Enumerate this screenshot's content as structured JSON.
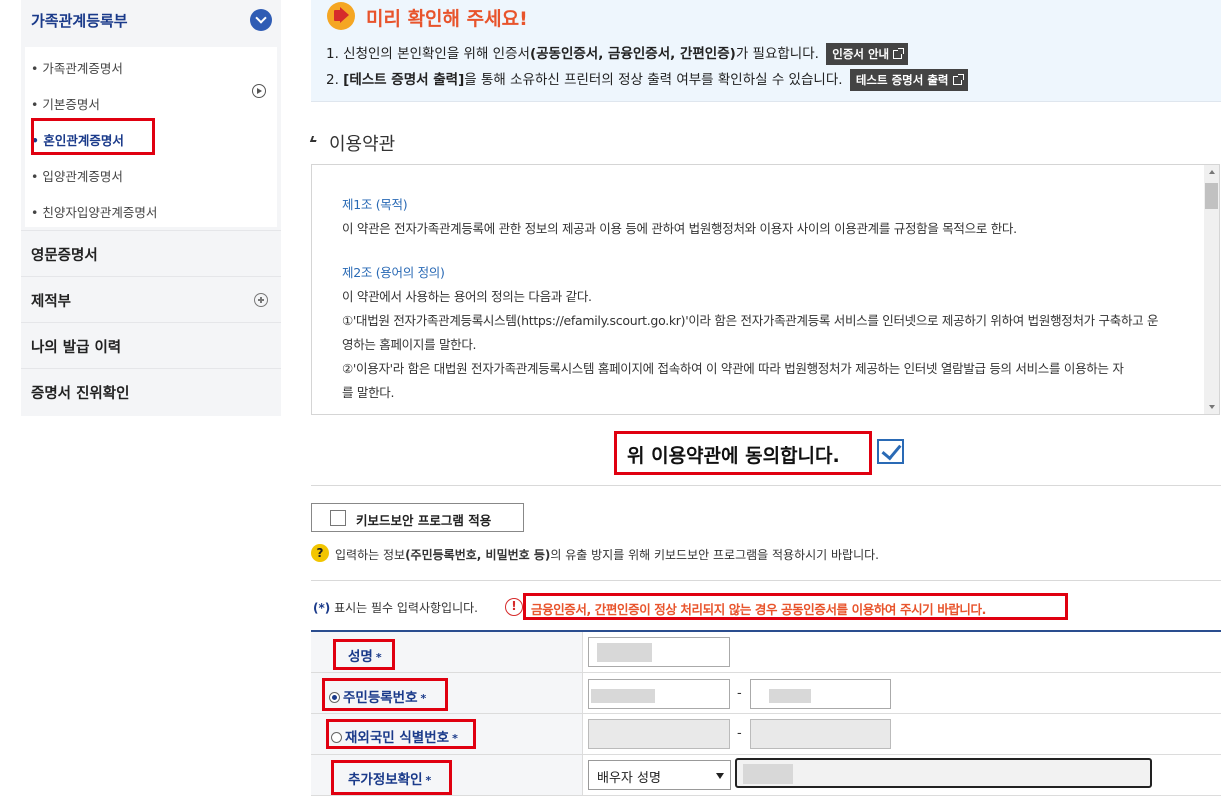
{
  "sidebar": {
    "header_label": "가족관계등록부",
    "sub_items": [
      {
        "label": "• 가족관계증명서"
      },
      {
        "label": "• 기본증명서"
      },
      {
        "label": "• 혼인관계증명서"
      },
      {
        "label": "• 입양관계증명서"
      },
      {
        "label": "• 친양자입양관계증명서"
      }
    ],
    "items": [
      {
        "label": "영문증명서"
      },
      {
        "label": "제적부"
      },
      {
        "label": "나의 발급 이력"
      },
      {
        "label": "증명서 진위확인"
      }
    ]
  },
  "notice": {
    "title": "미리 확인해 주세요!",
    "line1_pre": "1. 신청인의 본인확인을 위해 인증서",
    "line1_bold": "(공동인증서, 금융인증서, 간편인증)",
    "line1_post": "가 필요합니다.",
    "line1_button": "인증서 안내",
    "line2_pre": "2. ",
    "line2_bold": "[테스트 증명서 출력]",
    "line2_post": "을 통해 소유하신 프린터의 정상 출력 여부를 확인하실 수 있습니다.",
    "line2_button": "테스트 증명서 출력"
  },
  "terms": {
    "title": "이용약관",
    "lines": [
      "제1조 (목적)",
      "이 약관은 전자가족관계등록에 관한 정보의 제공과 이용 등에 관하여 법원행정처와 이용자 사이의 이용관계를 규정함을 목적으로 한다.",
      "제2조 (용어의 정의)",
      "이 약관에서 사용하는 용어의 정의는 다음과 같다.",
      "①'대법원 전자가족관계등록시스템(https://efamily.scourt.go.kr)'이라 함은 전자가족관계등록 서비스를 인터넷으로 제공하기 위하여 법원행정처가 구축하고 운",
      "영하는 홈페이지를 말한다.",
      "②'이용자'라 함은 대법원 전자가족관계등록시스템 홈페이지에 접속하여 이 약관에 따라 법원행정처가 제공하는 인터넷 열람발급 등의 서비스를 이용하는 자",
      "를 말한다."
    ],
    "agree_label": "위 이용약관에 동의합니다."
  },
  "keyboard": {
    "button_label": "키보드보안 프로그램 적용",
    "help_icon": "?",
    "help_pre": "입력하는 정보",
    "help_bold": "(주민등록번호, 비밀번호 등)",
    "help_post": "의 유출 방지를 위해 키보드보안 프로그램을 적용하시기 바랍니다."
  },
  "required_note": {
    "star": "(*)",
    "text": " 표시는 필수 입력사항입니다.",
    "warn_icon": "!",
    "warning": "금융인증서, 간편인증이 정상 처리되지 않는 경우 공동인증서를 이용하여 주시기 바랍니다."
  },
  "form": {
    "star": "*",
    "dash": "-",
    "name_label": "성명",
    "rrn_label": "주민등록번호",
    "foreigner_label": "재외국민 식별번호",
    "extra_label": "추가정보확인",
    "extra_select": "배우자 성명"
  },
  "colors": {
    "accent": "#1a3a8a",
    "highlight": "#e00010",
    "notice_title": "#e8542c"
  }
}
